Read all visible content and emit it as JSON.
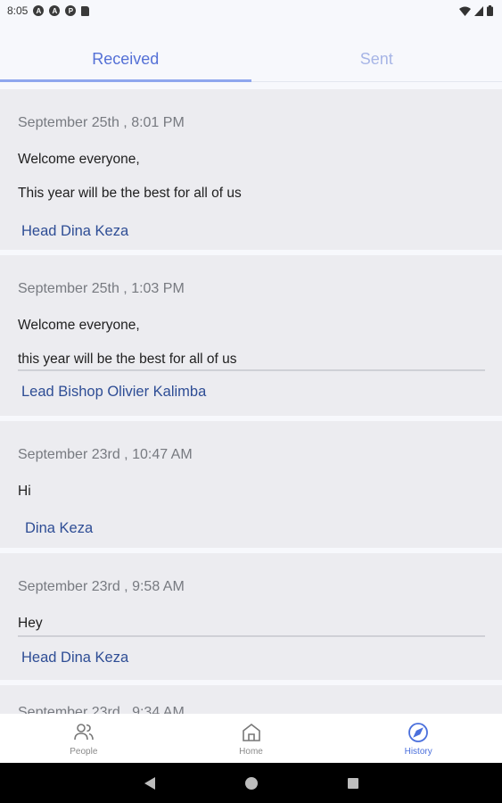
{
  "status_bar": {
    "time": "8:05"
  },
  "tabs": [
    {
      "label": "Received",
      "active": true
    },
    {
      "label": "Sent",
      "active": false
    }
  ],
  "messages": [
    {
      "date": "September 25th , 8:01 PM",
      "lines": [
        "Welcome everyone,",
        "This year will be the best for all of us"
      ],
      "sender": "Head Dina Keza",
      "divider": false
    },
    {
      "date": "September 25th , 1:03 PM",
      "lines": [
        "Welcome everyone,",
        "this year will be the best for all of us"
      ],
      "sender": "Lead Bishop Olivier Kalimba",
      "divider": true
    },
    {
      "date": "September 23rd , 10:47 AM",
      "lines": [
        "Hi"
      ],
      "sender": "Dina Keza",
      "divider": false
    },
    {
      "date": "September 23rd , 9:58 AM",
      "lines": [
        "Hey"
      ],
      "sender": "Head Dina Keza",
      "divider": true
    },
    {
      "date": "September 23rd , 9:34 AM",
      "lines": [],
      "sender": "",
      "divider": false
    }
  ],
  "bottom_nav": [
    {
      "label": "People",
      "icon": "people-icon",
      "active": false
    },
    {
      "label": "Home",
      "icon": "home-icon",
      "active": false
    },
    {
      "label": "History",
      "icon": "compass-icon",
      "active": true
    }
  ],
  "colors": {
    "accent": "#4a6fdc",
    "sender": "#2e4d95",
    "card_bg": "#ececf0"
  }
}
